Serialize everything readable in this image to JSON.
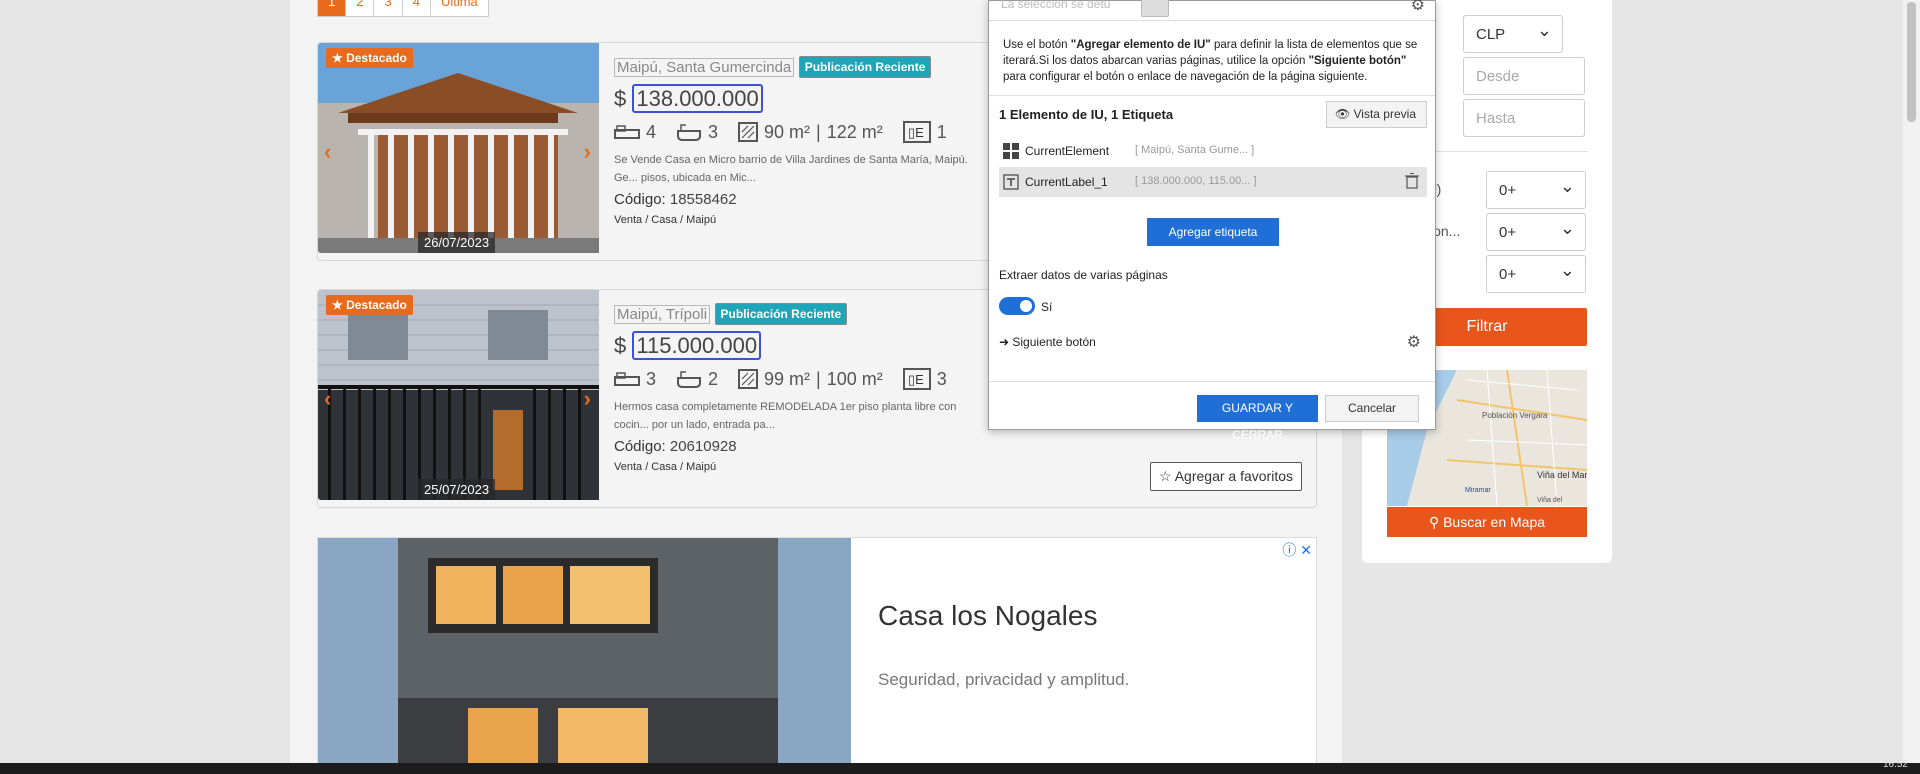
{
  "pagination": {
    "pages": [
      "1",
      "2",
      "3",
      "4"
    ],
    "last": "Última"
  },
  "listings": [
    {
      "featured": "★ Destacado",
      "date": "26/07/2023",
      "location": "Maipú, Santa Gumercinda",
      "tag": "Publicación Reciente",
      "currency": "$",
      "price": "138.000.000",
      "bedrooms": "4",
      "bathrooms": "3",
      "area_built": "90 m²",
      "area_total": "122 m²",
      "parking": "1",
      "description": "Se Vende Casa en Micro barrio de Villa Jardines de Santa María, Maipú. Ge... pisos, ubicada en Mic...",
      "code_label": "Código:",
      "code": "18558462",
      "breadcrumb": "Venta / Casa / Maipú"
    },
    {
      "featured": "★ Destacado",
      "date": "25/07/2023",
      "location": "Maipú, Trípoli",
      "tag": "Publicación Reciente",
      "currency": "$",
      "price": "115.000.000",
      "bedrooms": "3",
      "bathrooms": "2",
      "area_built": "99 m²",
      "area_total": "100 m²",
      "parking": "3",
      "description": "Hermos casa completamente REMODELADA 1er piso planta libre con cocin... por un lado, entrada pa...",
      "code_label": "Código:",
      "code": "20610928",
      "breadcrumb": "Venta / Casa / Maipú",
      "favorite_button": "☆ Agregar a favoritos"
    }
  ],
  "ad": {
    "title": "Casa los Nogales",
    "subtitle": "Seguridad, privacidad y amplitud.",
    "icons": "ⓘ ✕"
  },
  "sidebar": {
    "currency": "CLP",
    "from_placeholder": "Desde",
    "to_placeholder": "Hasta",
    "truncated_label_1": "²)",
    "truncated_label_2": "ion...",
    "select_values": [
      "0+",
      "0+",
      "0+"
    ],
    "filter_button": "Filtrar",
    "map_button": "Buscar en Mapa",
    "map_labels": {
      "place_1": "Población Vergara",
      "place_2": "Viña del Mar",
      "place_3": "Miramar",
      "place_4": "Viña del"
    }
  },
  "dialog": {
    "search_placeholder": "La selección se detu",
    "help_text_1": "Use el botón ",
    "help_bold_1": "\"Agregar elemento de IU\"",
    "help_text_2": " para definir la lista de elementos que se iterará.Si los datos abarcan varias páginas, utilice la opción ",
    "help_bold_2": "\"Siguiente botón\"",
    "help_text_3": " para configurar el botón o enlace de navegación de la página siguiente.",
    "count": "1 Elemento de IU, 1 Etiqueta",
    "preview_button": "Vista previa",
    "tree": [
      {
        "name": "CurrentElement",
        "value": "[ Maipú, Santa Gume... ]"
      },
      {
        "name": "CurrentLabel_1",
        "value": "[ 138.000.000, 115.00... ]"
      }
    ],
    "add_label_button": "Agregar etiqueta",
    "multi_page_label": "Extraer datos de varias páginas",
    "toggle_label": "Sí",
    "next_button_label": "Siguiente botón",
    "save_button": "GUARDAR Y CERRAR",
    "cancel_button": "Cancelar"
  },
  "taskbar": {
    "clock": "16:52"
  },
  "colors": {
    "accent": "#e86a1c",
    "tag": "#1fa5b7",
    "dialog_primary": "#1f6fd6",
    "selection": "#3b52d6"
  }
}
